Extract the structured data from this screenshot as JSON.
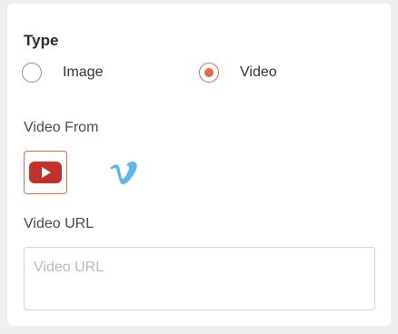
{
  "type_section": {
    "label": "Type",
    "options": [
      {
        "label": "Image",
        "selected": false
      },
      {
        "label": "Video",
        "selected": true
      }
    ]
  },
  "video_from": {
    "label": "Video From",
    "sources": [
      {
        "name": "youtube",
        "icon": "youtube-icon",
        "selected": true
      },
      {
        "name": "vimeo",
        "icon": "vimeo-icon",
        "selected": false
      }
    ]
  },
  "video_url": {
    "label": "Video URL",
    "value": "",
    "placeholder": "Video URL"
  },
  "colors": {
    "accent": "#e56a4c",
    "youtube_red": "#c4302b",
    "vimeo_blue": "#5cb8e6"
  }
}
